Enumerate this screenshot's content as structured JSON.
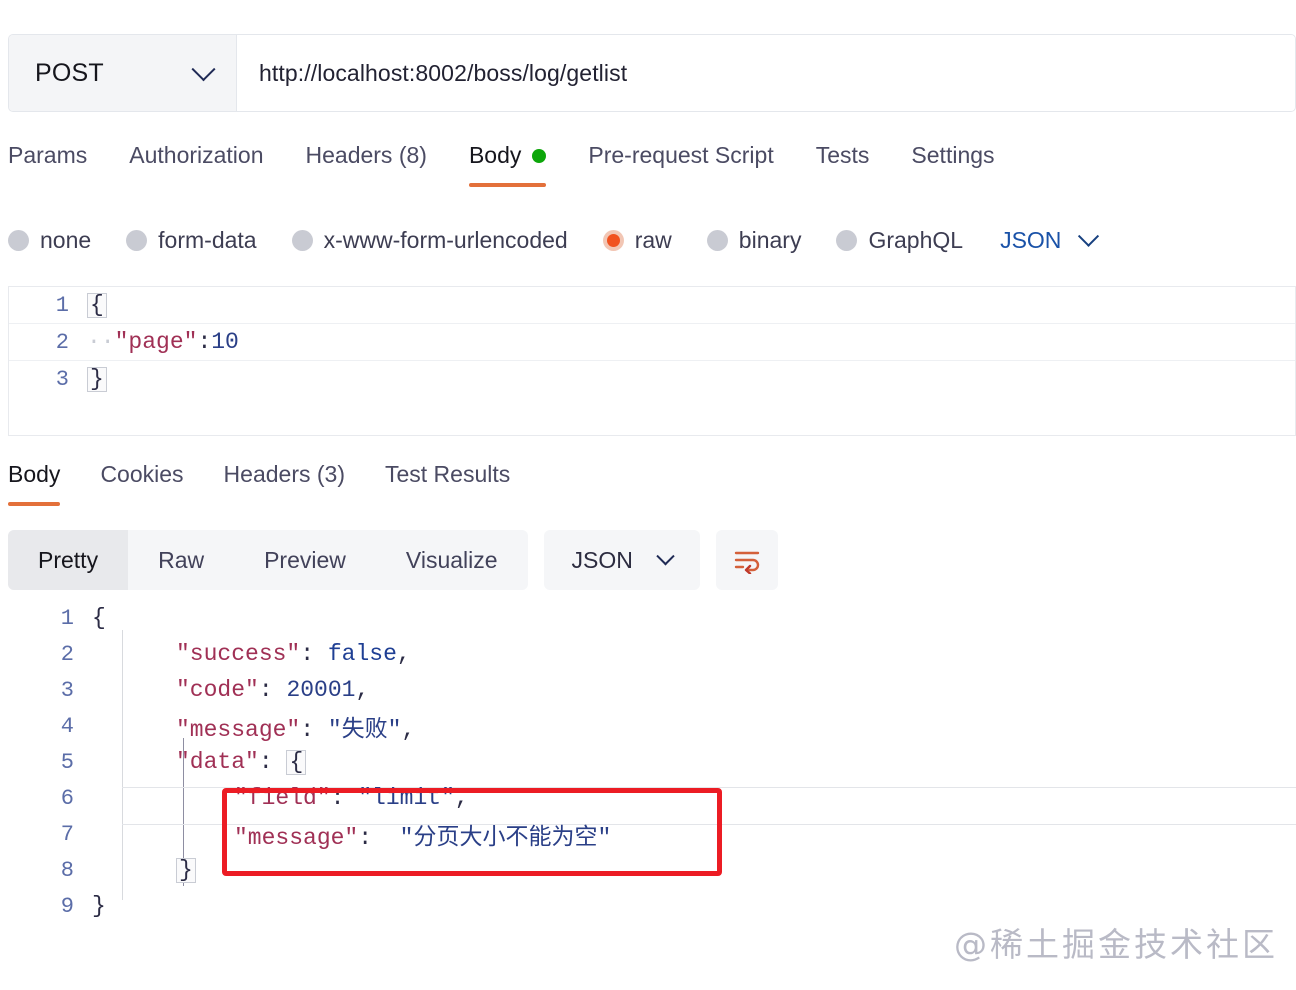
{
  "request": {
    "method": "POST",
    "url": "http://localhost:8002/boss/log/getlist",
    "tabs": [
      {
        "label": "Params"
      },
      {
        "label": "Authorization"
      },
      {
        "label": "Headers (8)"
      },
      {
        "label": "Body"
      },
      {
        "label": "Pre-request Script"
      },
      {
        "label": "Tests"
      },
      {
        "label": "Settings"
      }
    ],
    "active_tab": "Body",
    "body_types": [
      {
        "label": "none",
        "checked": false
      },
      {
        "label": "form-data",
        "checked": false
      },
      {
        "label": "x-www-form-urlencoded",
        "checked": false
      },
      {
        "label": "raw",
        "checked": true
      },
      {
        "label": "binary",
        "checked": false
      },
      {
        "label": "GraphQL",
        "checked": false
      }
    ],
    "format": "JSON",
    "editor_lines": [
      {
        "num": "1",
        "open_brace": "{",
        "text": ""
      },
      {
        "num": "2",
        "text": "  \"page\":10",
        "key": "\"page\"",
        "colon": ":",
        "value": "10"
      },
      {
        "num": "3",
        "close_brace": "}",
        "text": ""
      }
    ]
  },
  "response": {
    "tabs": [
      {
        "label": "Body"
      },
      {
        "label": "Cookies"
      },
      {
        "label": "Headers (3)"
      },
      {
        "label": "Test Results"
      }
    ],
    "active_tab": "Body",
    "view_modes": [
      {
        "label": "Pretty"
      },
      {
        "label": "Raw"
      },
      {
        "label": "Preview"
      },
      {
        "label": "Visualize"
      }
    ],
    "active_view": "Pretty",
    "format": "JSON",
    "wrap_icon": "wrap-text-icon",
    "lines": [
      {
        "num": "1",
        "indent": 0,
        "key": "",
        "colon": "",
        "value": "{",
        "type": "brace"
      },
      {
        "num": "2",
        "indent": 1,
        "key": "\"success\"",
        "colon": ":",
        "value": "false",
        "suffix": ",",
        "type": "bool"
      },
      {
        "num": "3",
        "indent": 1,
        "key": "\"code\"",
        "colon": ":",
        "value": "20001",
        "suffix": ",",
        "type": "num"
      },
      {
        "num": "4",
        "indent": 1,
        "key": "\"message\"",
        "colon": ":",
        "value": "\"失败\"",
        "suffix": ",",
        "type": "str"
      },
      {
        "num": "5",
        "indent": 1,
        "key": "\"data\"",
        "colon": ":",
        "value": "{",
        "suffix": "",
        "type": "brace"
      },
      {
        "num": "6",
        "indent": 2,
        "key": "\"field\"",
        "colon": ":",
        "value": "\"limit\"",
        "suffix": ",",
        "type": "str"
      },
      {
        "num": "7",
        "indent": 2,
        "key": "\"message\"",
        "colon": ":",
        "value": "\"分页大小不能为空\"",
        "suffix": "",
        "type": "str"
      },
      {
        "num": "8",
        "indent": 1,
        "key": "",
        "colon": "",
        "value": "}",
        "suffix": "",
        "type": "brace"
      },
      {
        "num": "9",
        "indent": 0,
        "key": "",
        "colon": "",
        "value": "}",
        "suffix": "",
        "type": "brace"
      }
    ]
  },
  "watermark": "@稀土掘金技术社区",
  "colors": {
    "accent_orange": "#f1521f",
    "tab_underline": "#e3703a",
    "status_green": "#0da60a",
    "highlight_red": "#ec1c24",
    "link_blue": "#1a52a8",
    "line_number": "#5b6da8",
    "json_key": "#a03055",
    "json_number": "#2a3f87"
  }
}
